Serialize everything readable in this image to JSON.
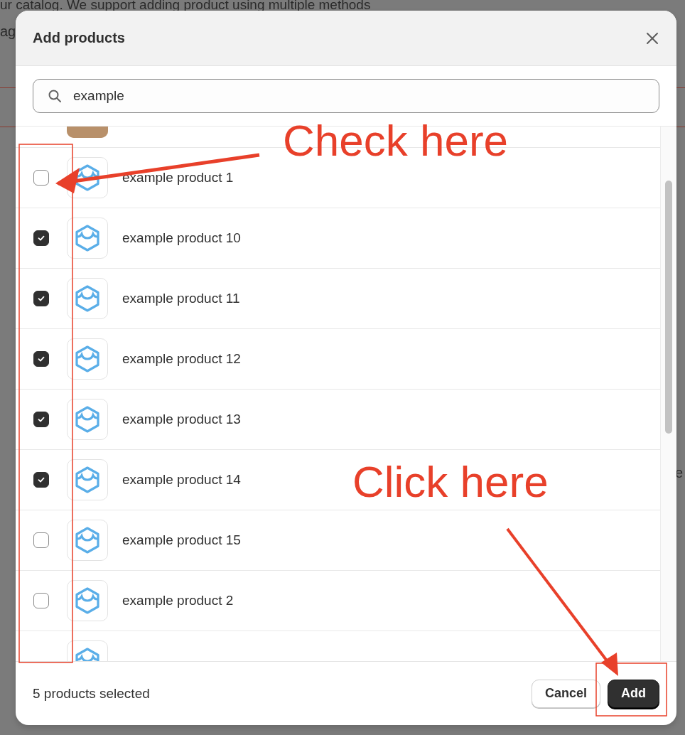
{
  "background": {
    "texts": [
      "ur catalog. We support adding product using multiple methods",
      "ag",
      "e"
    ]
  },
  "dialog": {
    "title": "Add products",
    "search": {
      "value": "example"
    },
    "rows": [
      {
        "kind": "partial-top"
      },
      {
        "kind": "product",
        "name": "example product 1",
        "checked": false
      },
      {
        "kind": "product",
        "name": "example product 10",
        "checked": true
      },
      {
        "kind": "product",
        "name": "example product 11",
        "checked": true
      },
      {
        "kind": "product",
        "name": "example product 12",
        "checked": true
      },
      {
        "kind": "product",
        "name": "example product 13",
        "checked": true
      },
      {
        "kind": "product",
        "name": "example product 14",
        "checked": true
      },
      {
        "kind": "product",
        "name": "example product 15",
        "checked": false
      },
      {
        "kind": "product",
        "name": "example product 2",
        "checked": false
      },
      {
        "kind": "partial-bottom"
      }
    ],
    "footer": {
      "status": "5 products selected",
      "buttons": [
        {
          "label": "Cancel",
          "kind": "secondary"
        },
        {
          "label": "Add",
          "kind": "primary"
        }
      ]
    }
  },
  "annotations": [
    {
      "text": "Check here"
    },
    {
      "text": "Click here"
    }
  ]
}
